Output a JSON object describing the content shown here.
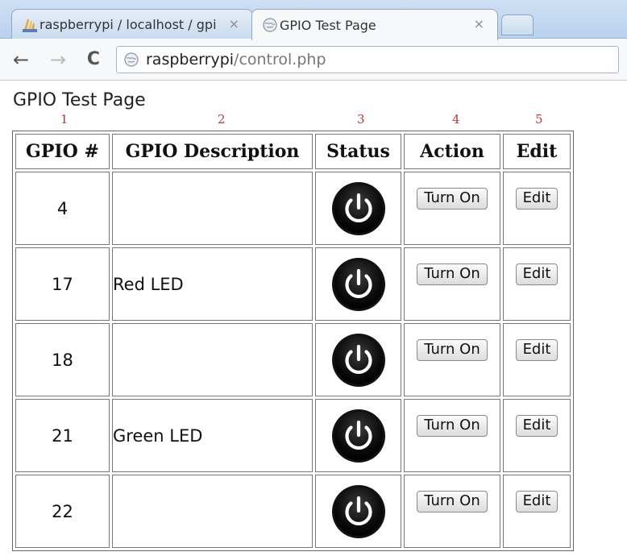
{
  "browser": {
    "tabs": [
      {
        "title": "raspberrypi / localhost / gpi",
        "close": "×",
        "active": false,
        "icon": "phpmyadmin-icon"
      },
      {
        "title": "GPIO Test Page",
        "close": "×",
        "active": true,
        "icon": "globe-icon"
      }
    ],
    "nav": {
      "back": "←",
      "forward": "→",
      "reload": "C"
    },
    "url": {
      "host": "raspberrypi",
      "path": "/control.php"
    }
  },
  "page": {
    "title": "GPIO Test Page",
    "column_numbers": [
      "1",
      "2",
      "3",
      "4",
      "5"
    ],
    "table": {
      "headers": [
        "GPIO #",
        "GPIO Description",
        "Status",
        "Action",
        "Edit"
      ],
      "rows": [
        {
          "pin": "4",
          "description": "",
          "status_icon": "power-icon",
          "action": "Turn On",
          "edit": "Edit"
        },
        {
          "pin": "17",
          "description": "Red LED",
          "status_icon": "power-icon",
          "action": "Turn On",
          "edit": "Edit"
        },
        {
          "pin": "18",
          "description": "",
          "status_icon": "power-icon",
          "action": "Turn On",
          "edit": "Edit"
        },
        {
          "pin": "21",
          "description": "Green LED",
          "status_icon": "power-icon",
          "action": "Turn On",
          "edit": "Edit"
        },
        {
          "pin": "22",
          "description": "",
          "status_icon": "power-icon",
          "action": "Turn On",
          "edit": "Edit"
        }
      ]
    }
  },
  "colors": {
    "column_number": "#b83a3a",
    "power_button": "#111111"
  }
}
